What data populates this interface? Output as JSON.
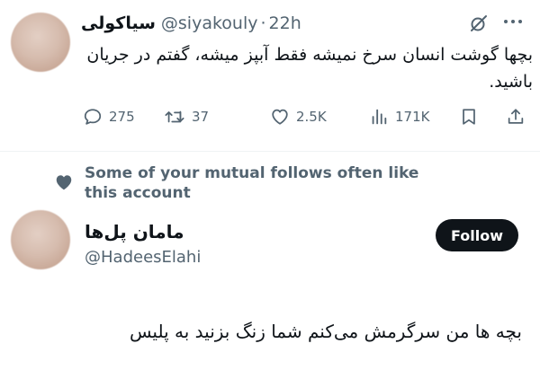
{
  "tweet": {
    "display_name": "سیاکولی",
    "handle": "@siyakouly",
    "separator": "·",
    "time": "22h",
    "text": "بچها گوشت انسان سرخ نمیشه فقط آبپز میشه، گفتم در جریان باشید.",
    "stats": {
      "replies": "275",
      "retweets": "37",
      "likes": "2.5K",
      "views": "171K"
    }
  },
  "suggestion": {
    "social_context": "Some of your mutual follows often like this account",
    "name": "مامان پل‌ها",
    "handle": "@HadeesElahi",
    "follow_label": "Follow"
  },
  "bottom_text": "بچه ها من سرگرمش می‌کنم شما زنگ بزنید به پلیس",
  "colors": {
    "text_primary": "#0f1419",
    "text_secondary": "#536471",
    "follow_button_bg": "#0f1419",
    "follow_button_text": "#ffffff",
    "divider": "#eff3f4"
  },
  "icons": [
    "reply-icon",
    "retweet-icon",
    "like-icon",
    "views-icon",
    "bookmark-icon",
    "share-icon",
    "grok-icon",
    "more-icon",
    "heart-icon"
  ]
}
